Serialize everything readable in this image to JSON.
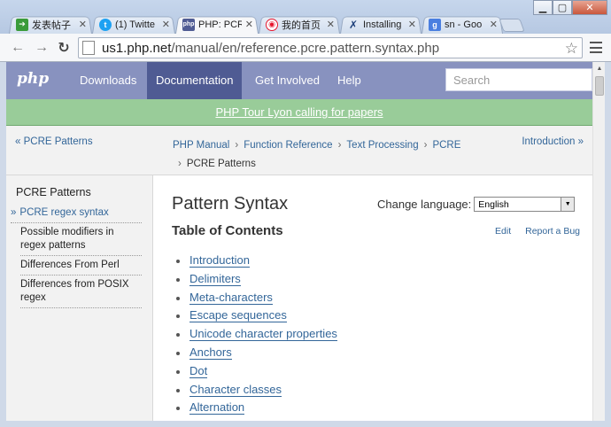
{
  "browser": {
    "tabs": [
      {
        "title": "发表帖子",
        "icon": "forum-icon",
        "color": "#3a9b3a",
        "active": false
      },
      {
        "title": "(1) Twitte",
        "icon": "twitter-icon",
        "color": "#1da1f2",
        "active": false
      },
      {
        "title": "PHP: PCR",
        "icon": "php-icon",
        "color": "#4f5b93",
        "active": true
      },
      {
        "title": "我的首页",
        "icon": "weibo-icon",
        "color": "#e6162d",
        "active": false
      },
      {
        "title": "Installing",
        "icon": "tool-icon",
        "color": "#1c3f7a",
        "active": false
      },
      {
        "title": "sn - Goo",
        "icon": "google-icon",
        "color": "#4a7fe0",
        "active": false
      }
    ],
    "url_host": "us1.php.net",
    "url_path": "/manual/en/reference.pcre.pattern.syntax.php"
  },
  "php_nav": {
    "logo": "php",
    "items": [
      "Downloads",
      "Documentation",
      "Get Involved",
      "Help"
    ],
    "active": "Documentation",
    "search_placeholder": "Search"
  },
  "banner": {
    "text": "PHP Tour Lyon calling for papers"
  },
  "breadcrumb": {
    "prev": "« PCRE Patterns",
    "next": "Introduction »",
    "items": [
      "PHP Manual",
      "Function Reference",
      "Text Processing",
      "PCRE"
    ],
    "current": "PCRE Patterns",
    "current_prefix": "›"
  },
  "sidebar": {
    "title": "PCRE Patterns",
    "current_marker": "»",
    "items": [
      {
        "label": "PCRE regex syntax",
        "current": true
      },
      {
        "label": "Possible modifiers in regex patterns",
        "current": false
      },
      {
        "label": "Differences From Perl",
        "current": false
      },
      {
        "label": "Differences from POSIX regex",
        "current": false
      }
    ]
  },
  "content": {
    "title": "Pattern Syntax",
    "toc_heading": "Table of Contents",
    "change_language_label": "Change language:",
    "language_selected": "English",
    "edit_label": "Edit",
    "report_label": "Report a Bug",
    "toc": [
      "Introduction",
      "Delimiters",
      "Meta-characters",
      "Escape sequences",
      "Unicode character properties",
      "Anchors",
      "Dot",
      "Character classes",
      "Alternation"
    ]
  }
}
